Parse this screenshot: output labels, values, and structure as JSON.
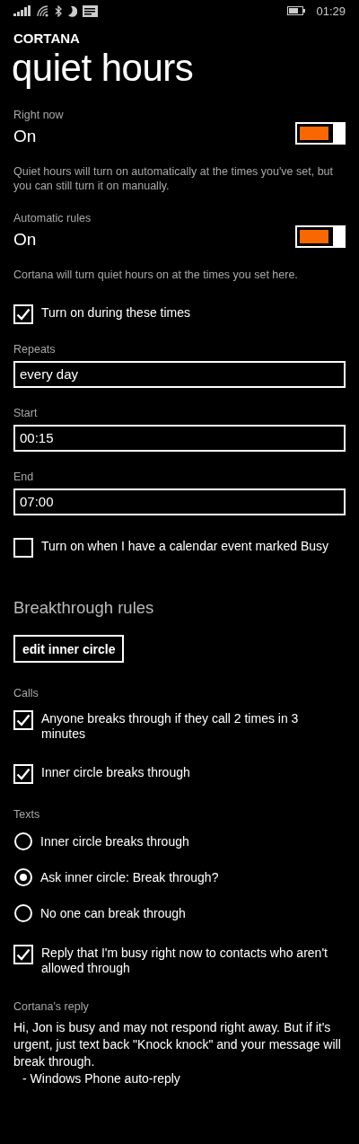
{
  "status_bar": {
    "time": "01:29"
  },
  "app_name": "CORTANA",
  "title": "quiet hours",
  "items": [
    {
      "kind": "toggle",
      "label": "Right now",
      "value": "On",
      "on": true
    },
    {
      "kind": "note",
      "text": "Quiet hours will turn on automatically at the times you've set, but you can still turn it on manually."
    },
    {
      "kind": "toggle",
      "label": "Automatic rules",
      "value": "On",
      "on": true
    },
    {
      "kind": "note",
      "text": "Cortana will turn quiet hours on at the times you set here."
    },
    {
      "kind": "checkbox",
      "label": "Turn on during these times",
      "checked": true
    },
    {
      "kind": "field",
      "label": "Repeats",
      "value": "every day"
    },
    {
      "kind": "field",
      "label": "Start",
      "value": "00:15"
    },
    {
      "kind": "field",
      "label": "End",
      "value": "07:00"
    },
    {
      "kind": "checkbox",
      "label": "Turn on when I have a calendar event marked Busy",
      "checked": false
    },
    {
      "kind": "heading",
      "text": "Breakthrough rules"
    },
    {
      "kind": "button",
      "text": "edit inner circle"
    },
    {
      "kind": "label",
      "text": "Calls"
    },
    {
      "kind": "checkbox",
      "label": "Anyone breaks through if they call 2 times in 3 minutes",
      "checked": true
    },
    {
      "kind": "checkbox",
      "label": "Inner circle breaks through",
      "checked": true
    },
    {
      "kind": "label",
      "text": "Texts"
    },
    {
      "kind": "radio",
      "label": "Inner circle breaks through",
      "selected": false
    },
    {
      "kind": "radio",
      "label": "Ask inner circle: Break through?",
      "selected": true
    },
    {
      "kind": "radio",
      "label": "No one can break through",
      "selected": false
    },
    {
      "kind": "checkbox",
      "label": "Reply that I'm busy right now to contacts who aren't allowed through",
      "checked": true
    },
    {
      "kind": "label",
      "text": "Cortana's reply"
    },
    {
      "kind": "paragraph",
      "text": "Hi, Jon is busy and may not respond right away. But if it's urgent, just text back \"Knock knock\" and your message will break through.",
      "signature": "- Windows Phone auto-reply"
    }
  ]
}
